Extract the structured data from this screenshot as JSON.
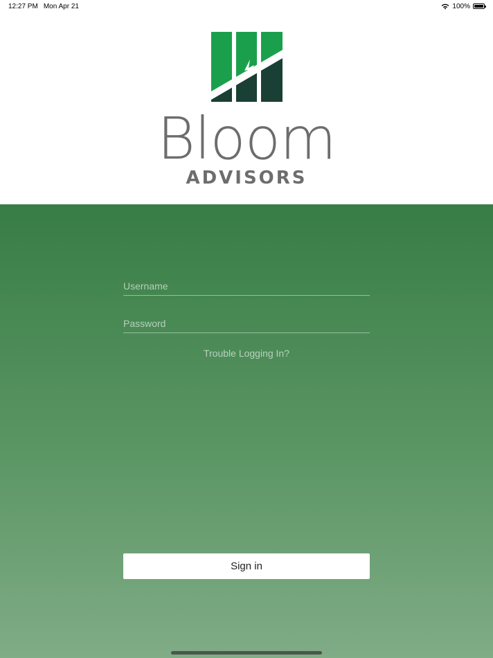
{
  "status_bar": {
    "time": "12:27 PM",
    "date": "Mon Apr 21",
    "battery": "100%"
  },
  "brand": {
    "name": "Bloom",
    "subtitle": "ADVISORS",
    "logo_colors": {
      "top": "#1aa04c",
      "bottom": "#1a3f34"
    }
  },
  "login": {
    "username_placeholder": "Username",
    "password_placeholder": "Password",
    "trouble_label": "Trouble Logging In?",
    "signin_label": "Sign in"
  },
  "colors": {
    "panel_top": "#387d45",
    "panel_bottom": "#80ac86"
  }
}
